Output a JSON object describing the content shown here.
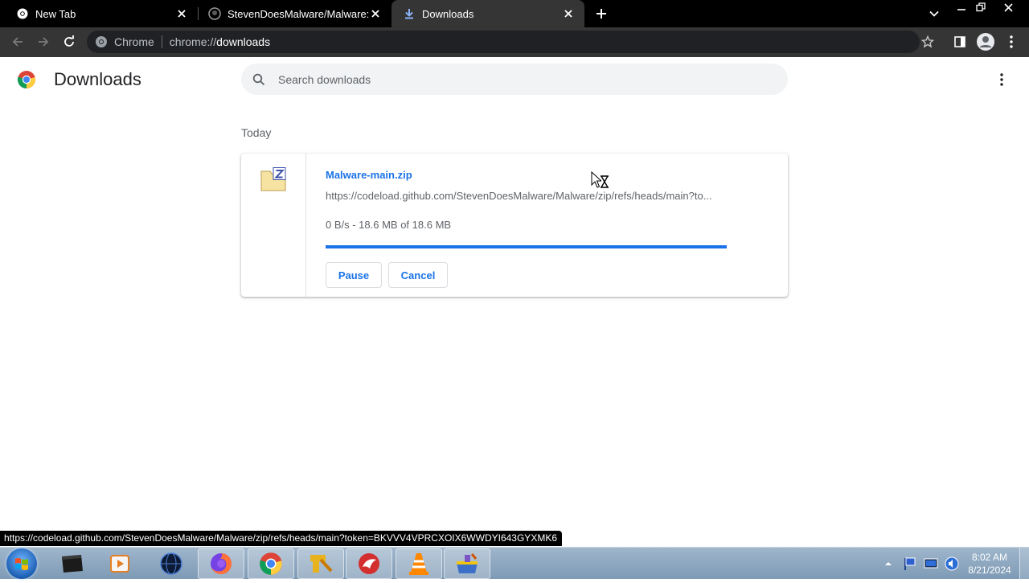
{
  "browser": {
    "tabs": [
      {
        "title": "New Tab",
        "icon": "chrome-icon",
        "active": false
      },
      {
        "title": "StevenDoesMalware/Malware: Us",
        "icon": "github-icon",
        "active": false
      },
      {
        "title": "Downloads",
        "icon": "download-icon",
        "active": true
      }
    ],
    "omnibox": {
      "chip": "Chrome",
      "url_scheme": "chrome://",
      "url_host": "downloads"
    }
  },
  "page": {
    "title": "Downloads",
    "search_placeholder": "Search downloads",
    "date_header": "Today",
    "download": {
      "file_name": "Malware-main.zip",
      "url": "https://codeload.github.com/StevenDoesMalware/Malware/zip/refs/heads/main?to...",
      "status": "0 B/s - 18.6 MB of 18.6 MB",
      "progress_percent": 100,
      "pause_label": "Pause",
      "cancel_label": "Cancel"
    }
  },
  "status_bubble": "https://codeload.github.com/StevenDoesMalware/Malware/zip/refs/heads/main?token=BKVVV4VPRCXOIX6WWDYI643GYXMK6",
  "taskbar": {
    "apps": [
      "terminal-icon",
      "media-player-icon",
      "dark-globe-icon",
      "firefox-icon",
      "chrome-icon",
      "sketch-icon",
      "red-app-icon",
      "vlc-icon",
      "archive-icon"
    ],
    "clock_time": "8:02 AM",
    "clock_date": "8/21/2024"
  },
  "colors": {
    "accent": "#1a73e8",
    "toolbar": "#353535",
    "tabstrip": "#000000",
    "progress_track": "#c6dafc"
  }
}
